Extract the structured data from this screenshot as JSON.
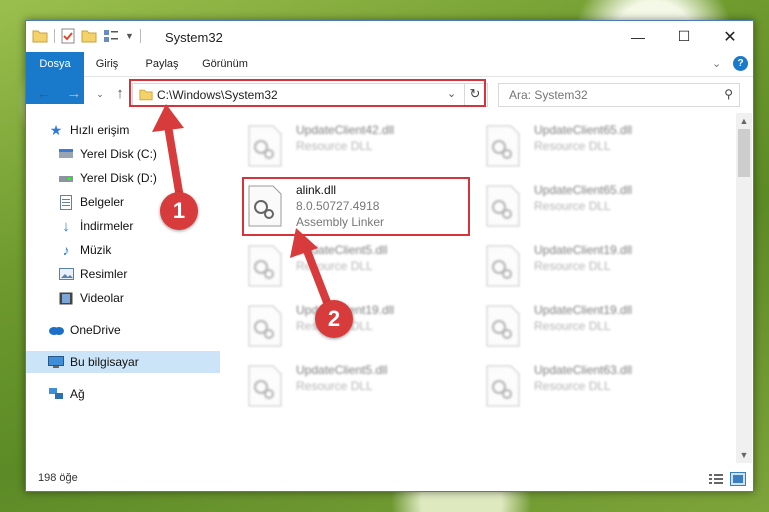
{
  "window": {
    "title": "System32"
  },
  "ribbon": {
    "tabs": [
      "Dosya",
      "Giriş",
      "Paylaş",
      "Görünüm"
    ]
  },
  "address": {
    "path": "C:\\Windows\\System32"
  },
  "search": {
    "placeholder": "Ara: System32"
  },
  "sidebar": {
    "items": [
      {
        "label": "Hızlı erişim",
        "icon": "star-icon"
      },
      {
        "label": "Yerel Disk (C:)",
        "icon": "drive-icon"
      },
      {
        "label": "Yerel Disk (D:)",
        "icon": "drive-icon"
      },
      {
        "label": "Belgeler",
        "icon": "documents-icon"
      },
      {
        "label": "İndirmeler",
        "icon": "download-icon"
      },
      {
        "label": "Müzik",
        "icon": "music-icon"
      },
      {
        "label": "Resimler",
        "icon": "pictures-icon"
      },
      {
        "label": "Videolar",
        "icon": "video-icon"
      },
      {
        "label": "OneDrive",
        "icon": "cloud-icon"
      },
      {
        "label": "Bu bilgisayar",
        "icon": "computer-icon"
      },
      {
        "label": "Ağ",
        "icon": "network-icon"
      }
    ]
  },
  "files": [
    {
      "name": "UpdateClient42.dll",
      "desc": "Resource DLL"
    },
    {
      "name": "UpdateClient65.dll",
      "desc": "Resource DLL"
    },
    {
      "name": "alink.dll",
      "version": "8.0.50727.4918",
      "desc": "Assembly Linker"
    },
    {
      "name": "UpdateClient65.dll",
      "desc": "Resource DLL"
    },
    {
      "name": "UpdateClient5.dll",
      "desc": "Resource DLL"
    },
    {
      "name": "UpdateClient19.dll",
      "desc": "Resource DLL"
    },
    {
      "name": "UpdateClient19.dll",
      "desc": "Resource DLL"
    },
    {
      "name": "UpdateClient19.dll",
      "desc": "Resource DLL"
    },
    {
      "name": "UpdateClient5.dll",
      "desc": "Resource DLL"
    },
    {
      "name": "UpdateClient63.dll",
      "desc": "Resource DLL"
    }
  ],
  "status": {
    "count": "198 öğe"
  },
  "annotations": [
    "1",
    "2"
  ],
  "colors": {
    "accent": "#1979ca",
    "highlight": "#d7333a",
    "selection": "#cce4f7"
  }
}
